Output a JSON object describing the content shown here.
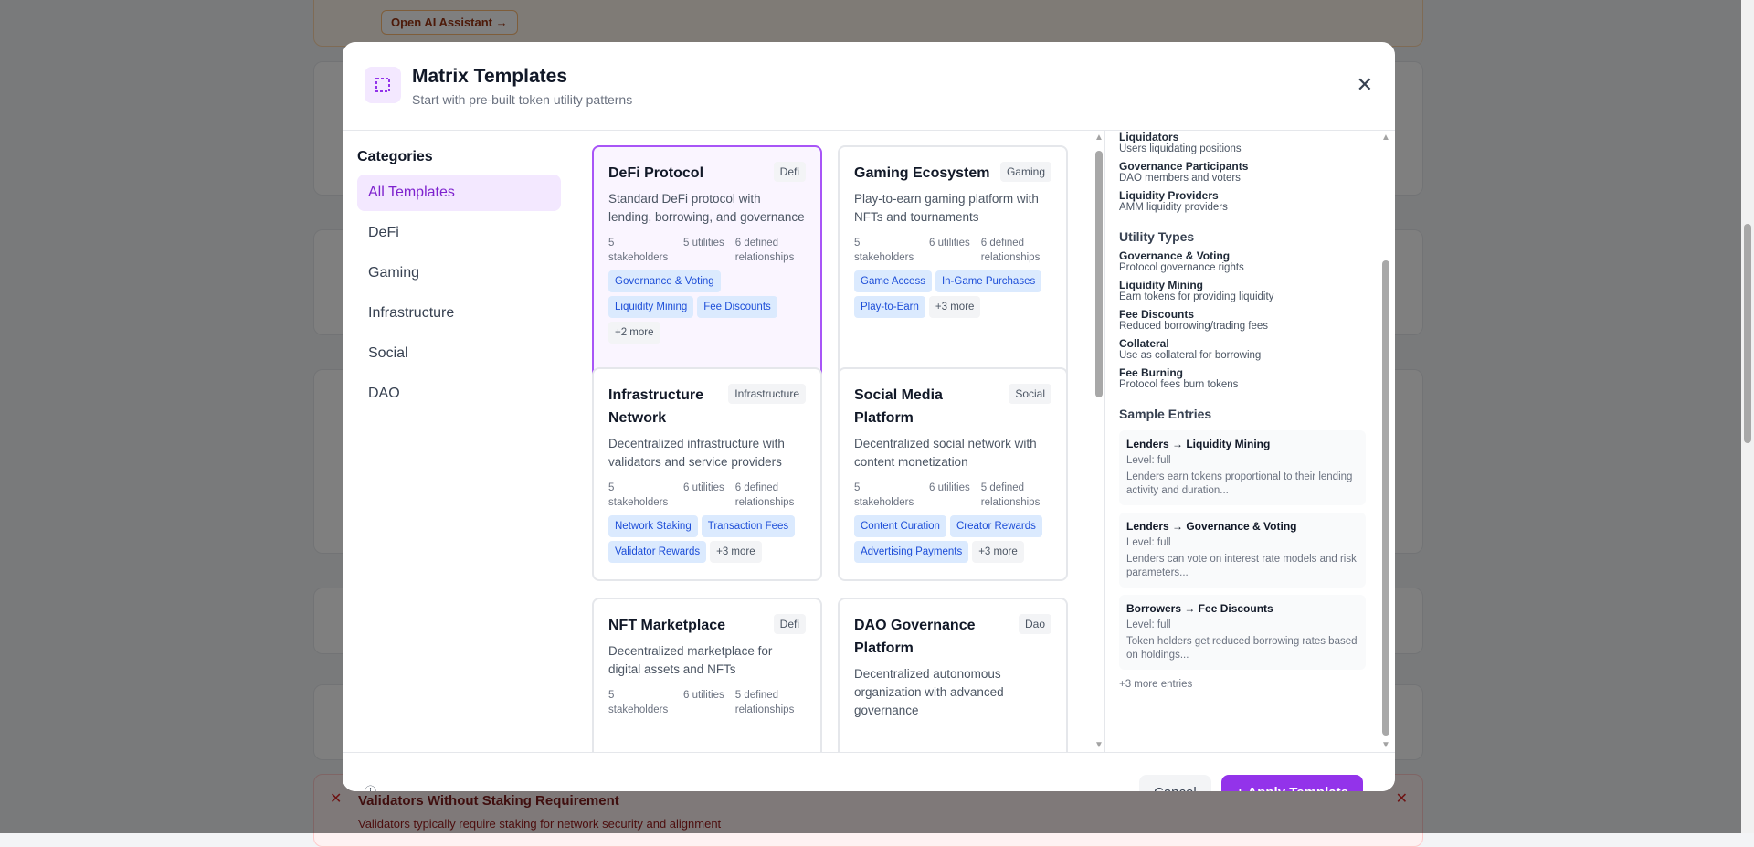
{
  "background": {
    "ai_button": "Open AI Assistant →",
    "alert_title": "Validators Without Staking Requirement",
    "alert_desc": "Validators typically require staking for network security and alignment",
    "alert_icon": "x-icon"
  },
  "modal": {
    "title": "Matrix Templates",
    "subtitle": "Start with pre-built token utility patterns",
    "close": "✕",
    "categories_title": "Categories",
    "categories": [
      "All Templates",
      "DeFi",
      "Gaming",
      "Infrastructure",
      "Social",
      "DAO"
    ],
    "active_category": 0,
    "templates": [
      {
        "title": "DeFi Protocol",
        "category": "Defi",
        "desc": "Standard DeFi protocol with lending, borrowing, and governance",
        "stakeholders": "5 stakeholders",
        "utilities": "5 utilities",
        "relationships": "6 defined relationships",
        "tags": [
          "Governance & Voting",
          "Liquidity Mining",
          "Fee Discounts"
        ],
        "more": "+2 more",
        "selected": true
      },
      {
        "title": "Gaming Ecosystem",
        "category": "Gaming",
        "desc": "Play-to-earn gaming platform with NFTs and tournaments",
        "stakeholders": "5 stakeholders",
        "utilities": "6 utilities",
        "relationships": "6 defined relationships",
        "tags": [
          "Game Access",
          "In-Game Purchases",
          "Play-to-Earn"
        ],
        "more": "+3 more"
      },
      {
        "title": "Infrastructure Network",
        "category": "Infrastructure",
        "desc": "Decentralized infrastructure with validators and service providers",
        "stakeholders": "5 stakeholders",
        "utilities": "6 utilities",
        "relationships": "6 defined relationships",
        "tags": [
          "Network Staking",
          "Transaction Fees",
          "Validator Rewards"
        ],
        "more": "+3 more"
      },
      {
        "title": "Social Media Platform",
        "category": "Social",
        "desc": "Decentralized social network with content monetization",
        "stakeholders": "5 stakeholders",
        "utilities": "6 utilities",
        "relationships": "5 defined relationships",
        "tags": [
          "Content Curation",
          "Creator Rewards",
          "Advertising Payments"
        ],
        "more": "+3 more"
      },
      {
        "title": "NFT Marketplace",
        "category": "Defi",
        "desc": "Decentralized marketplace for digital assets and NFTs",
        "stakeholders": "5 stakeholders",
        "utilities": "6 utilities",
        "relationships": "5 defined relationships",
        "tags": [],
        "more": ""
      },
      {
        "title": "DAO Governance Platform",
        "category": "Dao",
        "desc": "Decentralized autonomous organization with advanced governance",
        "stakeholders": "",
        "utilities": "",
        "relationships": "",
        "tags": [],
        "more": ""
      }
    ],
    "detail": {
      "stakeholders": [
        {
          "name": "Liquidators",
          "desc": "Users liquidating positions"
        },
        {
          "name": "Governance Participants",
          "desc": "DAO members and voters"
        },
        {
          "name": "Liquidity Providers",
          "desc": "AMM liquidity providers"
        }
      ],
      "utility_title": "Utility Types",
      "utilities": [
        {
          "name": "Governance & Voting",
          "desc": "Protocol governance rights"
        },
        {
          "name": "Liquidity Mining",
          "desc": "Earn tokens for providing liquidity"
        },
        {
          "name": "Fee Discounts",
          "desc": "Reduced borrowing/trading fees"
        },
        {
          "name": "Collateral",
          "desc": "Use as collateral for borrowing"
        },
        {
          "name": "Fee Burning",
          "desc": "Protocol fees burn tokens"
        }
      ],
      "samples_title": "Sample Entries",
      "samples": [
        {
          "name": "Lenders → Liquidity Mining",
          "level": "Level: full",
          "desc": "Lenders earn tokens proportional to their lending activity and duration..."
        },
        {
          "name": "Lenders → Governance & Voting",
          "level": "Level: full",
          "desc": "Lenders can vote on interest rate models and risk parameters..."
        },
        {
          "name": "Borrowers → Fee Discounts",
          "level": "Level: full",
          "desc": "Token holders get reduced borrowing rates based on holdings..."
        }
      ],
      "more_entries": "+3 more entries"
    },
    "footer": {
      "info_icon": "ⓘ",
      "cancel": "Cancel",
      "apply": "+ Apply Template"
    }
  },
  "colors": {
    "accent": "#9333ea",
    "tag_bg": "#dbeafe",
    "tag_fg": "#1d4ed8",
    "selected_border": "#a855f7"
  }
}
